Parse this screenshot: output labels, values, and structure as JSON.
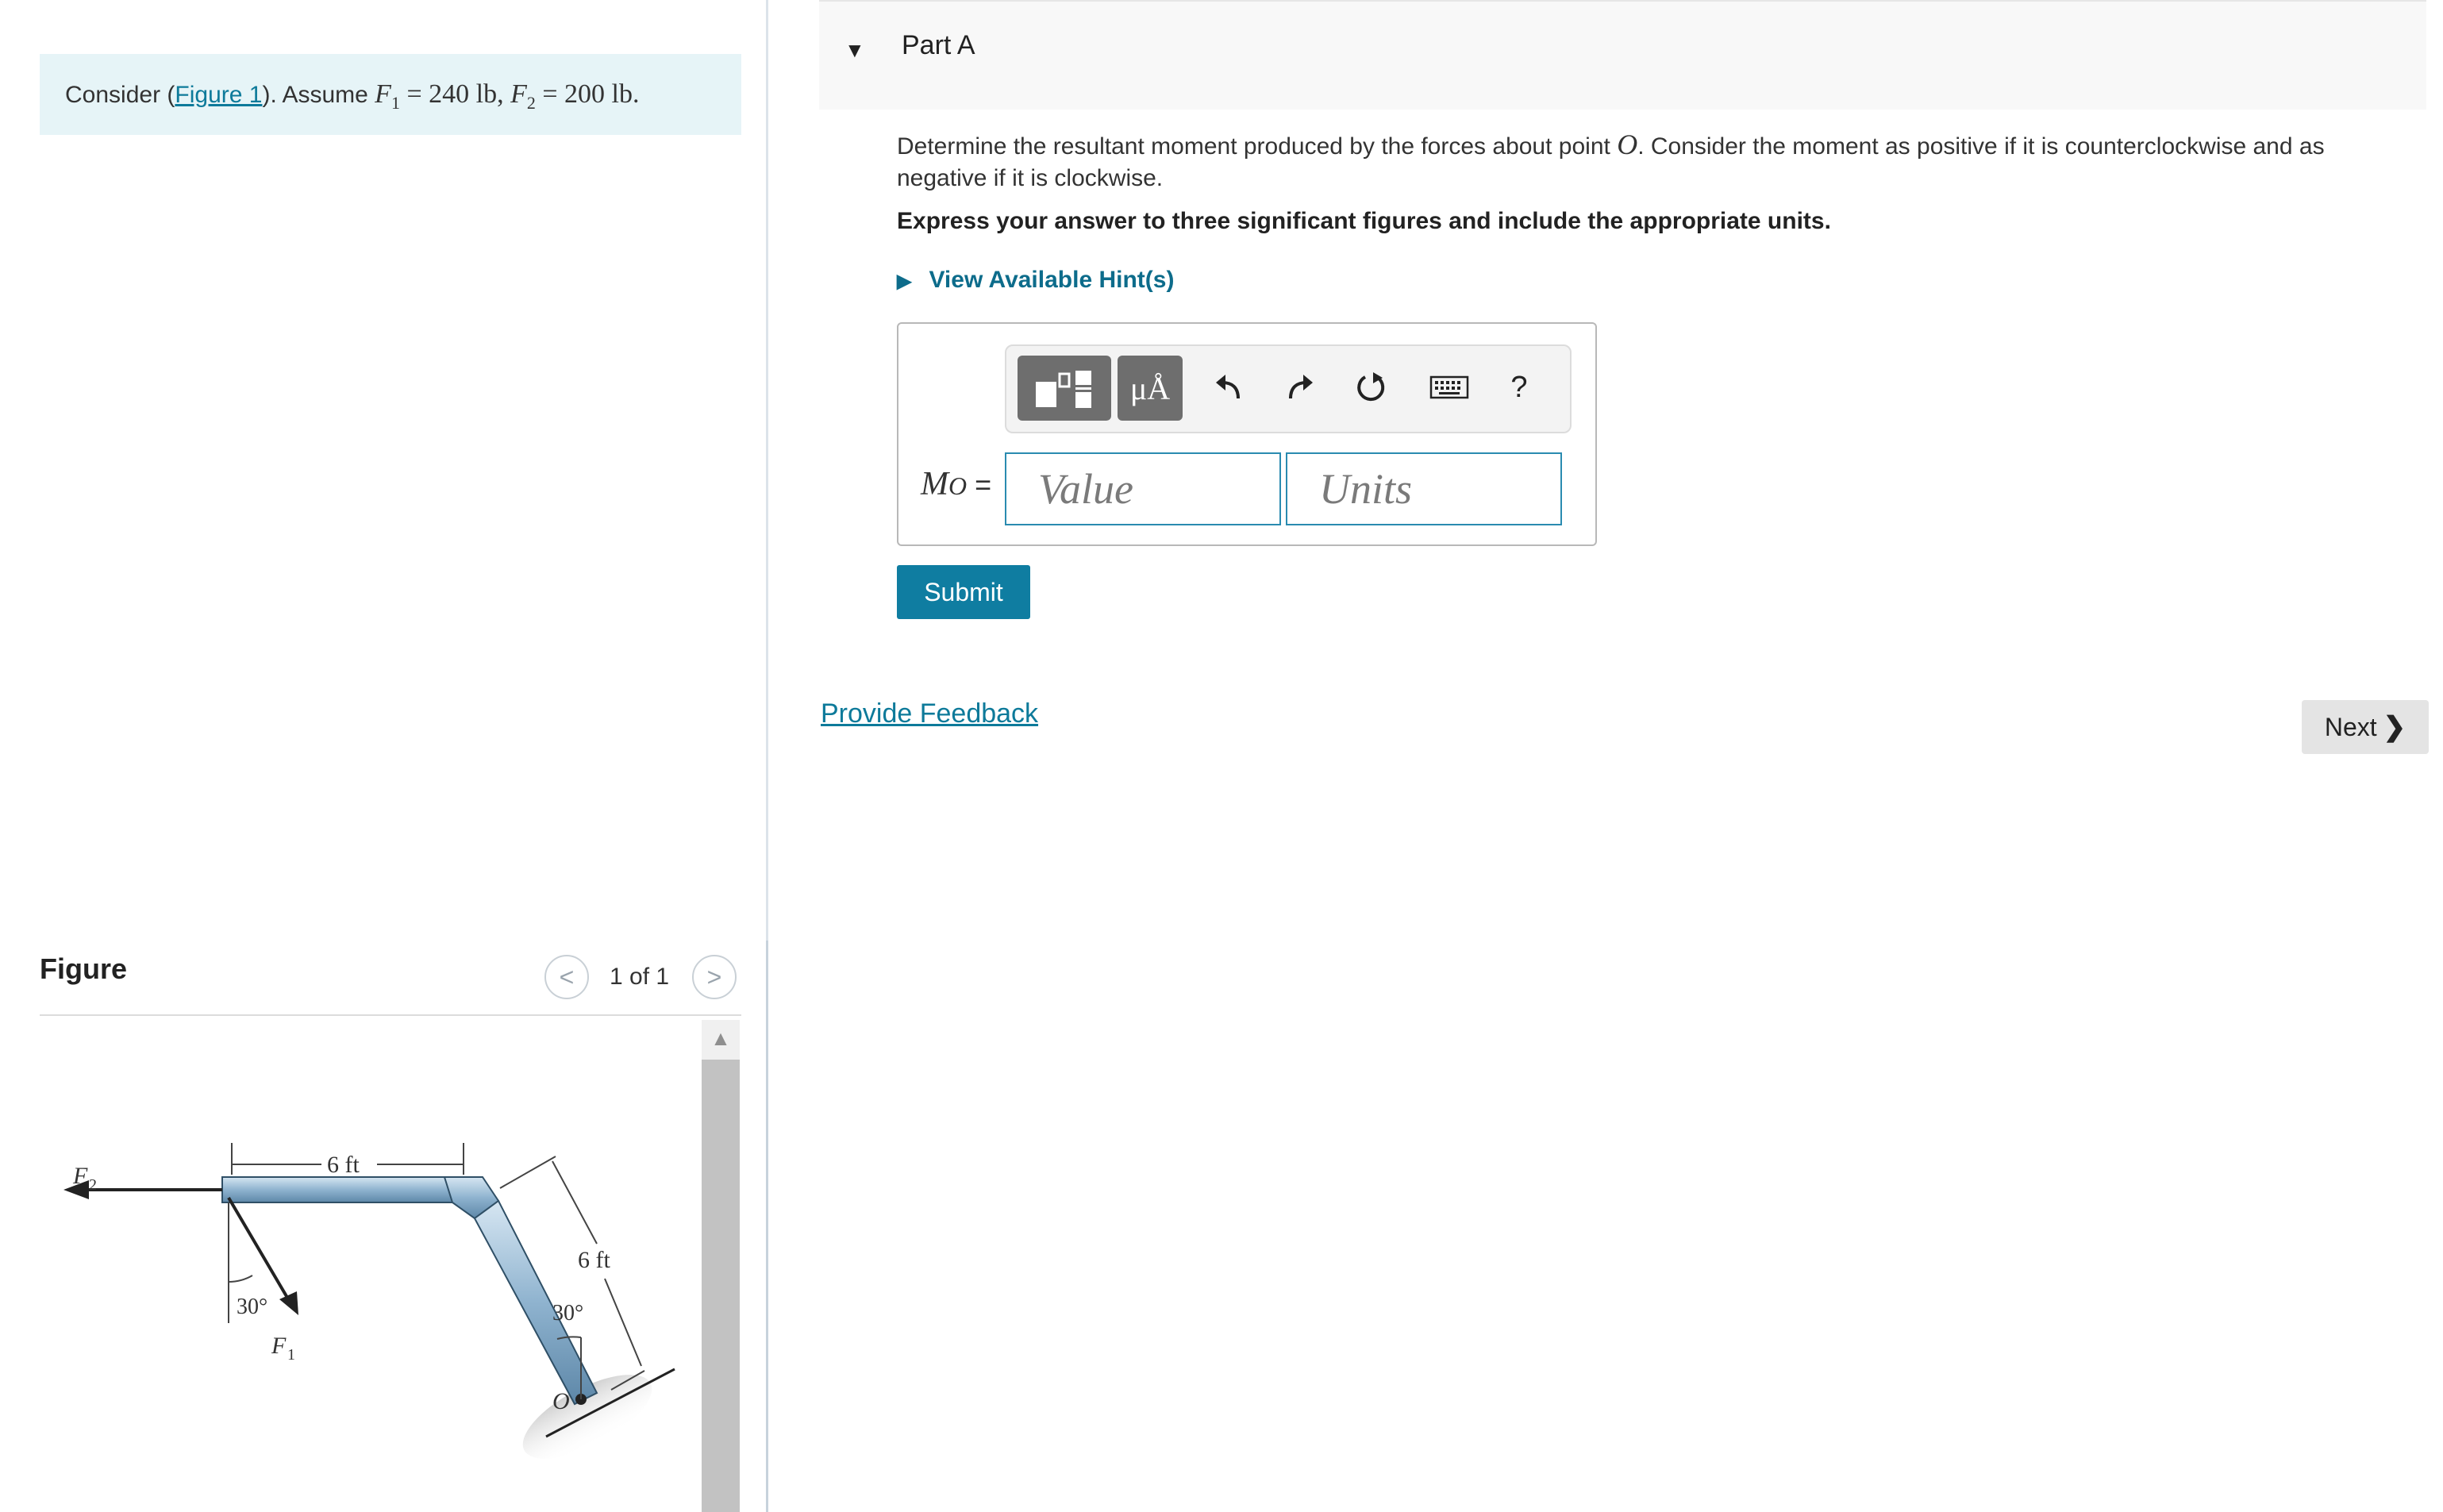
{
  "problem": {
    "consider": "Consider (",
    "figure_link": "Figure 1",
    "close": "). Assume ",
    "f1_sym": "F",
    "f1_sub": "1",
    "f1_val": " = 240 lb, ",
    "f2_sym": "F",
    "f2_sub": "2",
    "f2_val": " = 200 lb."
  },
  "figure_panel": {
    "title": "Figure",
    "counter": "1 of 1",
    "prev": "<",
    "next": ">",
    "labels": {
      "F2": "F",
      "F2_sub": "2",
      "F1": "F",
      "F1_sub": "1",
      "dim_top": "6 ft",
      "dim_diag": "6 ft",
      "angle_left": "30°",
      "angle_right": "30°",
      "point": "O"
    }
  },
  "part": {
    "title": "Part A",
    "question_start": "Determine the resultant moment produced by the forces about point ",
    "question_point": "O",
    "question_end": ". Consider the moment as positive if it is counterclockwise and as negative if it is clockwise.",
    "instruction": "Express your answer to three significant figures and include the appropriate units.",
    "hints": "View Available Hint(s)",
    "answer_label_m": "M",
    "answer_label_sub": "O",
    "answer_label_eq": " =",
    "value_placeholder": "Value",
    "units_placeholder": "Units",
    "units_button": "μÅ",
    "help": "?",
    "submit": "Submit",
    "feedback": "Provide Feedback",
    "next": "Next"
  },
  "icons": [
    "templates-icon",
    "units-icon",
    "undo-icon",
    "redo-icon",
    "reset-icon",
    "keyboard-icon",
    "help-icon"
  ],
  "colors": {
    "accent": "#0f7da1",
    "link": "#0d7a9a",
    "problem_bg": "#e6f4f7",
    "beam": "#8fb3cf"
  }
}
